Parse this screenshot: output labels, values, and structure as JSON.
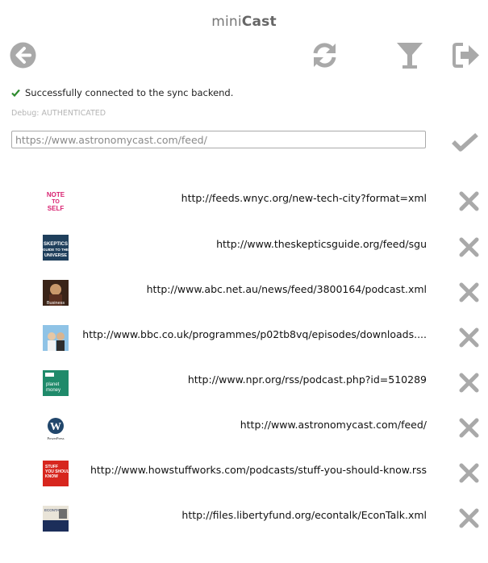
{
  "app": {
    "title_light": "mini",
    "title_bold": "Cast"
  },
  "toolbar": {
    "back_icon": "arrow-left-circle",
    "refresh_icon": "refresh",
    "filter_icon": "funnel",
    "logout_icon": "sign-out"
  },
  "status": {
    "text": "Successfully connected to the sync backend.",
    "color": "#2e8b2e"
  },
  "debug": {
    "text": "Debug: AUTHENTICATED"
  },
  "add_feed": {
    "placeholder": "https://www.astronomycast.com/feed/",
    "add_icon": "checkmark"
  },
  "feeds": [
    {
      "url": "http://feeds.wnyc.org/new-tech-city?format=xml",
      "artwork": "NOTE TO SELF"
    },
    {
      "url": "http://www.theskepticsguide.org/feed/sgu",
      "artwork": "SKEPTICS GUIDE TO THE UNIVERSE"
    },
    {
      "url": "http://www.abc.net.au/news/feed/3800164/podcast.xml",
      "artwork": "The Business"
    },
    {
      "url": "http://www.bbc.co.uk/programmes/p02tb8vq/episodes/downloads....",
      "artwork": ""
    },
    {
      "url": "http://www.npr.org/rss/podcast.php?id=510289",
      "artwork": "planet money"
    },
    {
      "url": "http://www.astronomycast.com/feed/",
      "artwork": "PowerPress"
    },
    {
      "url": "http://www.howstuffworks.com/podcasts/stuff-you-should-know.rss",
      "artwork": "STUFF YOU SHOULD KNOW"
    },
    {
      "url": "http://files.libertyfund.org/econtalk/EconTalk.xml",
      "artwork": "ECONTALK"
    }
  ],
  "delete_icon": "close-x",
  "colors": {
    "icon_gray": "#a9a9a9",
    "text": "#111111"
  }
}
